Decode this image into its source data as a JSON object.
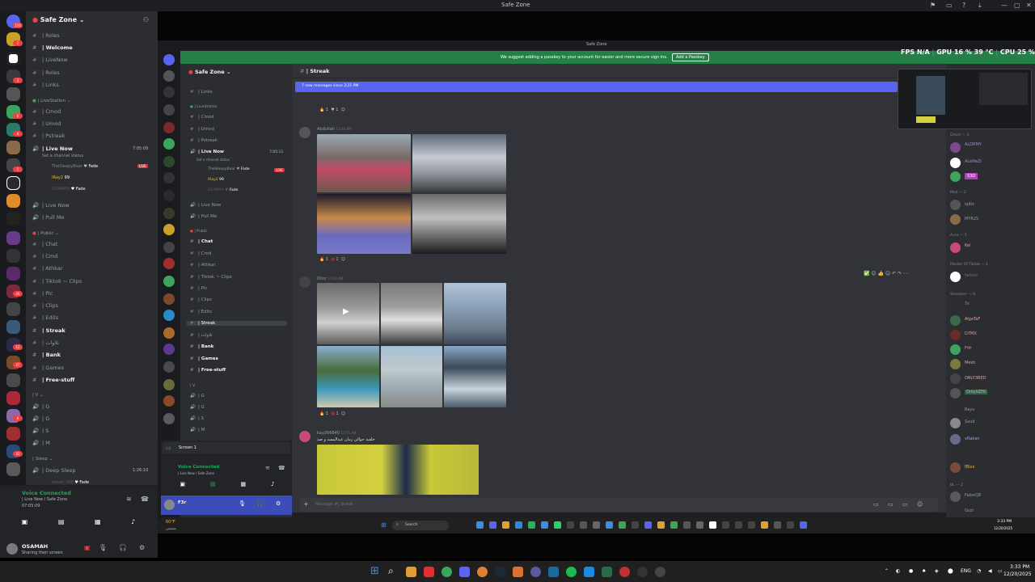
{
  "window": {
    "title": "Safe Zone"
  },
  "outer": {
    "server_name": "Safe Zone",
    "rail_badges": [
      "234",
      "2",
      "3",
      "6",
      "4",
      "1",
      "2",
      "2",
      "1",
      "44",
      "12",
      "47",
      "1",
      "8",
      "13",
      "42",
      "15",
      "15",
      "17",
      "16",
      "12",
      "32",
      "22",
      "6"
    ],
    "channels": [
      {
        "icon": "#",
        "label": "| Roles",
        "style": "normal"
      },
      {
        "icon": "#",
        "label": "| Welcome",
        "style": "bright"
      },
      {
        "icon": "#",
        "label": "| LiveNow",
        "style": "normal"
      },
      {
        "icon": "#",
        "label": "| Roles",
        "style": "normal"
      },
      {
        "icon": "#",
        "label": "| Links",
        "style": "normal"
      }
    ],
    "category_livestation": "| LiveStation",
    "livestation_channels": [
      {
        "icon": "#",
        "label": "| Cmod"
      },
      {
        "icon": "#",
        "label": "| Umod"
      },
      {
        "icon": "#",
        "label": "| Pstreak"
      }
    ],
    "live_now": {
      "label": "| Live Now",
      "timer": "7:05:09",
      "status": "Set a channel status"
    },
    "voice_users": [
      {
        "name": "TheSleepyBear",
        "tag": "Fade",
        "live": "LIVE"
      },
      {
        "name": "IRay2",
        "tag": "99"
      },
      {
        "name": "OSAMAH",
        "tag": "Fade"
      }
    ],
    "voice_channels2": [
      "| Live Now",
      "| Pull Me"
    ],
    "category_public": "| Public",
    "public_channels": [
      {
        "label": "| Chat",
        "style": "normal"
      },
      {
        "label": "| Cmd",
        "style": "normal"
      },
      {
        "label": "| Athkar",
        "style": "normal"
      },
      {
        "label": "| Tiktok ~ Clips",
        "style": "normal"
      },
      {
        "label": "| Pic",
        "style": "normal"
      },
      {
        "label": "| Clips",
        "style": "normal"
      },
      {
        "label": "| Edits",
        "style": "normal"
      },
      {
        "label": "| Streak",
        "style": "bright"
      },
      {
        "label": "| تلاوات",
        "style": "normal"
      },
      {
        "label": "| Bank",
        "style": "bright"
      },
      {
        "label": "| Games",
        "style": "normal"
      },
      {
        "label": "| Free-stuff",
        "style": "bright"
      }
    ],
    "category_v": "| V",
    "v_channels": [
      "| G",
      "| G",
      "| S",
      "| M"
    ],
    "category_sleep": "| Sleep",
    "deep_sleep": {
      "label": "| Deep Sleep",
      "timer": "1:26:10",
      "user": "Aboot_300",
      "user_tag": "Fade"
    },
    "voice_connected": {
      "title": "Voice Connected",
      "sub": "| Live Now / Safe Zone",
      "time": "07:05:09"
    },
    "user": {
      "name": "OSAMAH",
      "status": "Sharing their screen"
    }
  },
  "inner": {
    "title": "Safe Zone",
    "passkey_msg": "We suggest adding a passkey to your account for easier and more secure sign ins.",
    "passkey_btn": "Add a Passkey",
    "fps": "FPS",
    "fps_val": "N/A",
    "gpu": "GPU",
    "gpu_val": "16 % 39 °C",
    "cpu": "CPU",
    "cpu_val": "25 %",
    "server_name": "Safe Zone",
    "channels": [
      {
        "label": "| Links",
        "y": 0
      },
      {
        "label": "| LiveStation",
        "cat": true
      },
      {
        "label": "| Cmod"
      },
      {
        "label": "| Umod"
      },
      {
        "label": "| Pstreak"
      }
    ],
    "live_now": {
      "label": "| Live Now",
      "timer": "7:05:11",
      "status": "Set a channel status"
    },
    "voice_users": [
      {
        "name": "TheSleepyBear",
        "tag": "Fade",
        "live": "LIVE"
      },
      {
        "name": "IRay2",
        "tag": "99"
      },
      {
        "name": "OSAMAH",
        "tag": "Fade"
      }
    ],
    "voice_channels2": [
      "| Live Now",
      "| Pull Me"
    ],
    "category_public": "| Public",
    "public_channels": [
      {
        "label": "| Chat",
        "style": "bright"
      },
      {
        "label": "| Cmd",
        "style": "normal"
      },
      {
        "label": "| Athkar",
        "style": "normal"
      },
      {
        "label": "| Tiktok ~ Clips",
        "style": "normal"
      },
      {
        "label": "| Pic",
        "style": "normal"
      },
      {
        "label": "| Clips",
        "style": "normal"
      },
      {
        "label": "| Edits",
        "style": "normal"
      },
      {
        "label": "| Streak",
        "style": "selected"
      },
      {
        "label": "| تلاوات",
        "style": "normal"
      },
      {
        "label": "| Bank",
        "style": "bright"
      },
      {
        "label": "| Games",
        "style": "bright"
      },
      {
        "label": "| Free-stuff",
        "style": "bright"
      }
    ],
    "category_v": "| V",
    "v_channels": [
      "| G",
      "| G",
      "| S",
      "| M"
    ],
    "screen_label": "Screen 1",
    "voice_connected": {
      "title": "Voice Connected",
      "sub": "| Live Now / Safe Zone"
    },
    "user": {
      "name": "F3r"
    },
    "chat_channel": "| Streak",
    "new_messages": "7 new messages since 3:21 PM",
    "messages": [
      {
        "author": "Abdullah",
        "time": "11:48 AM"
      },
      {
        "author": "iDior",
        "time": "11:49 AM"
      },
      {
        "author": "kay266840",
        "time": "11:55 AM",
        "text": "خلفية جوالي زمان عبدالمسد و صد"
      }
    ],
    "reaction_count": "1",
    "input_placeholder": "Message #| Streak",
    "member_groups": [
      {
        "category": "Ghost — 3",
        "members": [
          "ALDRMY",
          "ALeNeZi",
          "S3D"
        ]
      },
      {
        "category": "Mod — 2",
        "members": [
          "iq4lz",
          "MYR2S"
        ]
      },
      {
        "category": "Aura — 1",
        "members": [
          "Kel"
        ]
      },
      {
        "category": "Master Of Tiktok — 1",
        "members": [
          "fwlxxx"
        ]
      },
      {
        "category": "Streamer — 6",
        "members": [
          "7s",
          "AlgaTaF",
          "D7MX",
          "Frfr",
          "Mesh",
          "ONLY3BED",
          "OnlyVZFK",
          "Rays",
          "Saud",
          "vRakan",
          "fBlxx"
        ]
      },
      {
        "category": "BL — 2",
        "members": [
          "FabioQ8",
          "Gozi"
        ]
      }
    ],
    "taskbar_temp": "60°F",
    "taskbar_temp_sub": "مشمس",
    "search": "Search",
    "clock_time": "3:33 PM",
    "clock_date": "12/20/2025"
  },
  "taskbar": {
    "lang": "ENG",
    "time": "3:33 PM",
    "date": "12/20/2025"
  },
  "colors": {
    "brand": "#5865f2",
    "live": "#da373c",
    "green": "#248046"
  }
}
